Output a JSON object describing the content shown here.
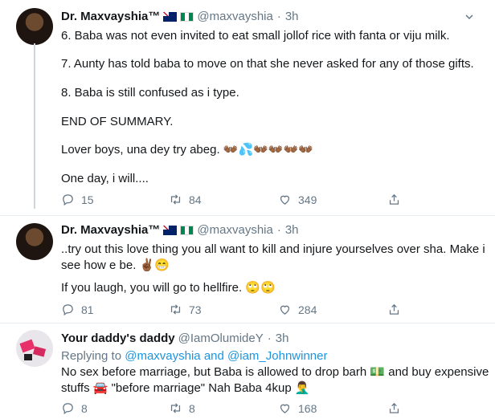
{
  "tweets": [
    {
      "name": "Dr. Maxvayshia™",
      "flags": [
        "🇦🇺",
        "🇳🇬"
      ],
      "handle": "@maxvayshia",
      "dot": "·",
      "time": "3h",
      "lines": [
        "6. Baba was not even invited to eat small jollof rice with fanta or viju milk.",
        "7. Aunty has told baba to move on that she never asked for any of those gifts.",
        "8. Baba is still confused as i type.",
        "END OF SUMMARY.",
        "Lover boys, una dey try abeg. 👐🏾💦👐🏾👐🏾👐🏾👐🏾",
        "One day, i will...."
      ],
      "replies": "15",
      "retweets": "84",
      "likes": "349"
    },
    {
      "name": "Dr. Maxvayshia™",
      "flags": [
        "🇦🇺",
        "🇳🇬"
      ],
      "handle": "@maxvayshia",
      "dot": "·",
      "time": "3h",
      "lines": [
        "..try out this love thing you all want to kill and injure yourselves over sha. Make i",
        "see how e be. ✌🏾😁",
        "If you laugh, you will go to hellfire. 🙄🙄"
      ],
      "replies": "81",
      "retweets": "73",
      "likes": "284"
    },
    {
      "name": "Your daddy's daddy",
      "handle": "@IamOlumideY",
      "dot": "·",
      "time": "3h",
      "replying_prefix": "Replying to",
      "replying_user1": "@maxvayshia",
      "replying_and": "and",
      "replying_user2": "@iam_Johnwinner",
      "lines": [
        "No sex before marriage, but Baba is allowed to drop barh 💵 and buy expensive",
        "stuffs 🚘 \"before marriage\" Nah Baba 4kup 🤦‍♂️"
      ],
      "replies": "8",
      "retweets": "8",
      "likes": "168"
    }
  ],
  "icons": {
    "reply": "reply-icon",
    "retweet": "retweet-icon",
    "like": "like-icon",
    "share": "share-icon",
    "more": "chevron-down-icon"
  },
  "colors": {
    "text": "#14171a",
    "secondary": "#657786",
    "link": "#1b95e0",
    "divider": "#e6ecf0"
  }
}
